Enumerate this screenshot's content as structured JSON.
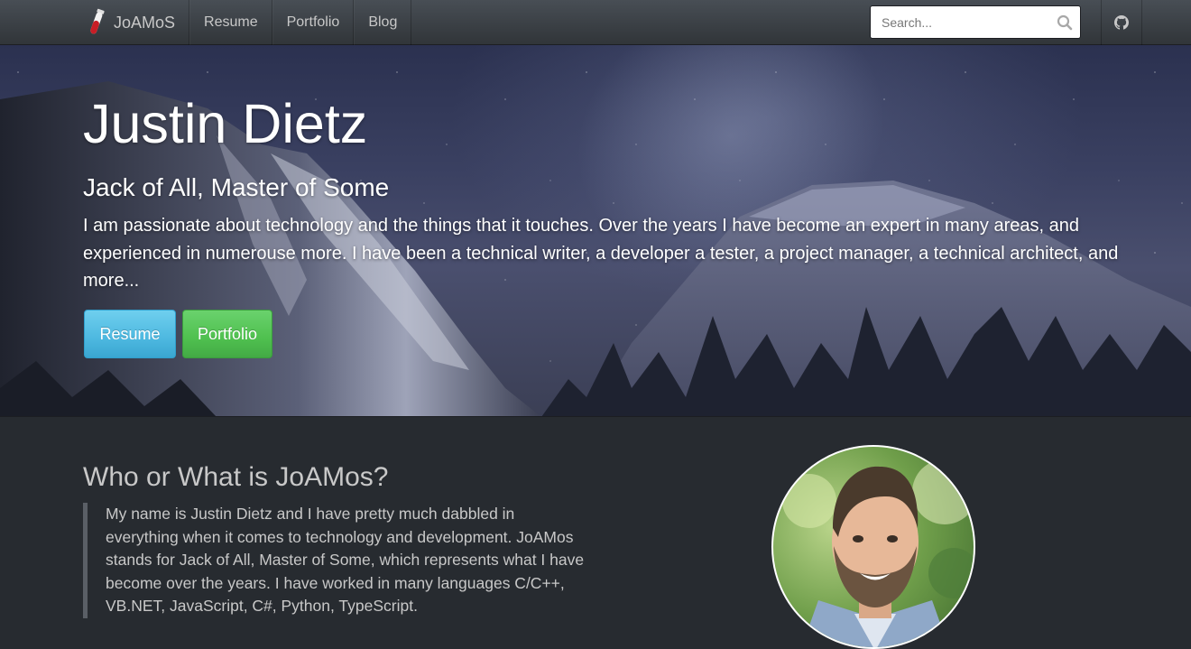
{
  "nav": {
    "brand": "JoAMoS",
    "links": [
      "Resume",
      "Portfolio",
      "Blog"
    ],
    "search_placeholder": "Search...",
    "brand_icon": "test-tube-icon",
    "search_icon": "search-icon",
    "github_icon": "github-icon"
  },
  "hero": {
    "title": "Justin Dietz",
    "subtitle": "Jack of All, Master of Some",
    "text": "I am passionate about technology and the things that it touches. Over the years I have become an expert in many areas, and experienced in numerouse more. I have been a technical writer, a developer a tester, a project manager, a technical architect, and more...",
    "buttons": {
      "resume": "Resume",
      "portfolio": "Portfolio"
    }
  },
  "about": {
    "heading": "Who or What is JoAMos?",
    "quote": "My name is Justin Dietz and I have pretty much dabbled in everything when it comes to technology and development. JoAMos stands for Jack of All, Master of Some, which represents what I have become over the years. I have worked in many languages C/C++, VB.NET, JavaScript, C#, Python, TypeScript."
  },
  "colors": {
    "navbar": "#3a3f44",
    "body_bg": "#272b30",
    "btn_info": "#5bc0de",
    "btn_success": "#62c462"
  }
}
